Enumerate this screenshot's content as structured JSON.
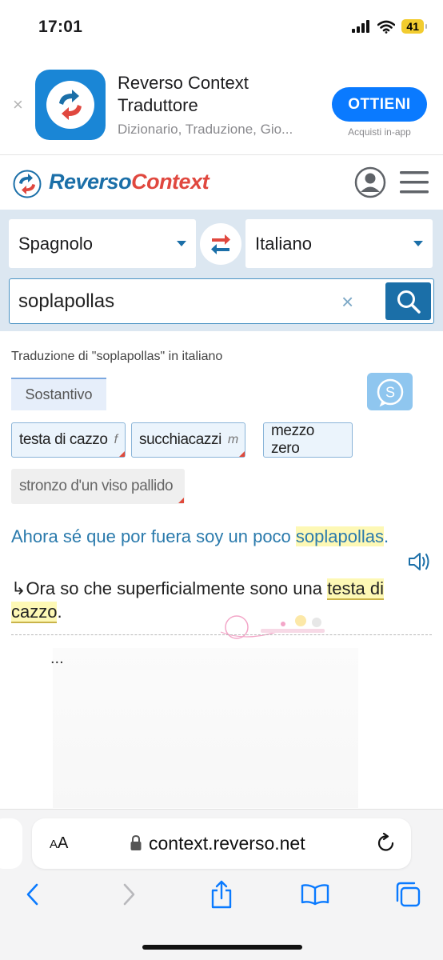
{
  "status_bar": {
    "time": "17:01",
    "battery": "41"
  },
  "app_banner": {
    "close": "×",
    "app_name": "Reverso Context Traduttore",
    "subtitle": "Dizionario, Traduzione, Gio...",
    "get_button": "OTTIENI",
    "in_app": "Acquisti in-app"
  },
  "header": {
    "logo_part1": "Reverso",
    "logo_part2": "Context"
  },
  "search": {
    "source_lang": "Spagnolo",
    "target_lang": "Italiano",
    "query": "soplapollas",
    "clear": "×"
  },
  "results": {
    "heading": "Traduzione di \"soplapollas\" in italiano",
    "pos": "Sostantivo",
    "translations": [
      {
        "text": "testa di cazzo",
        "gender": "f"
      },
      {
        "text": "succhiacazzi",
        "gender": "m"
      },
      {
        "text": "mezzo zero",
        "gender": ""
      },
      {
        "text": "stronzo d'un viso pallido",
        "gender": ""
      }
    ],
    "example": {
      "source_before": "Ahora sé que por fuera soy un poco ",
      "source_highlight": "soplapollas",
      "source_after": ".",
      "arrow": "↳",
      "target_before": "Ora so che superficialmente sono una ",
      "target_highlight": "testa di cazzo",
      "target_after": "."
    },
    "more": "..."
  },
  "browser": {
    "aa_small": "A",
    "aa_large": "A",
    "url": "context.reverso.net"
  },
  "colors": {
    "brand_blue": "#1b6fa8",
    "brand_red": "#e0483f",
    "ios_blue": "#0a7aff"
  }
}
